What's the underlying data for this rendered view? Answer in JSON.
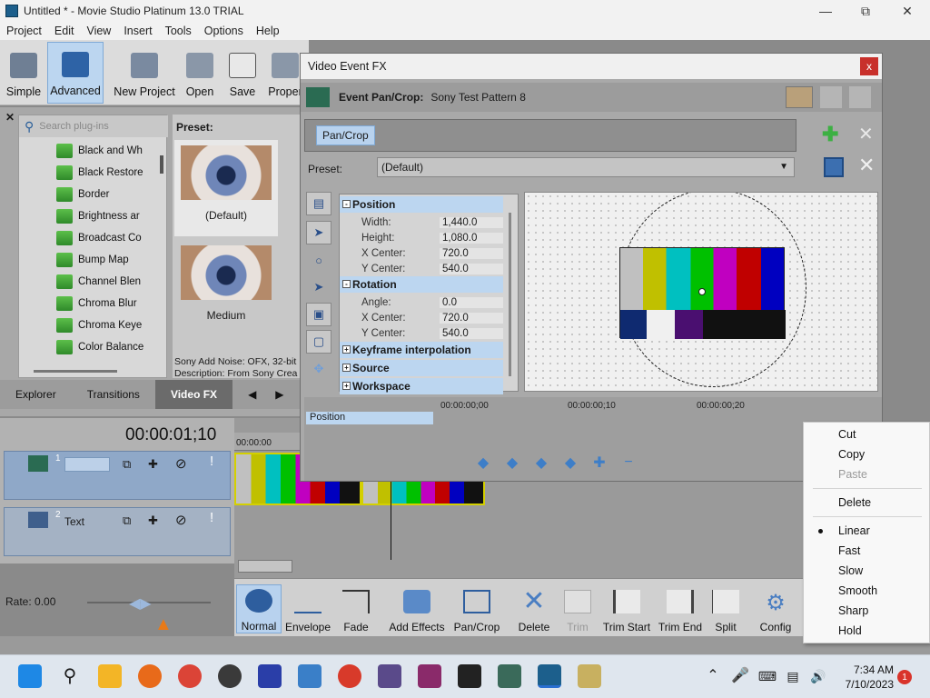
{
  "window": {
    "title": "Untitled * - Movie Studio Platinum 13.0 TRIAL"
  },
  "menu": [
    "Project",
    "Edit",
    "View",
    "Insert",
    "Tools",
    "Options",
    "Help"
  ],
  "toolbar": [
    "Simple",
    "Advanced",
    "New Project",
    "Open",
    "Save",
    "Proper"
  ],
  "plugins": {
    "search_placeholder": "Search plug-ins",
    "items": [
      "Black and Wh",
      "Black Restore",
      "Border",
      "Brightness ar",
      "Broadcast Co",
      "Bump Map",
      "Channel Blen",
      "Chroma Blur",
      "Chroma Keye",
      "Color Balance"
    ]
  },
  "presets": {
    "label": "Preset:",
    "thumbs": [
      "(Default)",
      "Medium"
    ],
    "desc1": "Sony Add Noise: OFX, 32-bit",
    "desc2": "Description: From Sony Crea"
  },
  "tabs": [
    "Explorer",
    "Transitions",
    "Video FX"
  ],
  "timeline": {
    "timecode": "00:00:01;10",
    "ruler_start": "00:00:00",
    "tracks": [
      {
        "num": "1",
        "name": ""
      },
      {
        "num": "2",
        "name": "Text"
      }
    ],
    "rate": "Rate: 0.00"
  },
  "bottom_tools": [
    "Normal",
    "Envelope",
    "Fade",
    "Add Effects",
    "Pan/Crop",
    "Delete",
    "Trim",
    "Trim Start",
    "Trim End",
    "Split",
    "Config"
  ],
  "fx": {
    "title": "Video Event FX",
    "close": "x",
    "header_label": "Event Pan/Crop:",
    "header_value": "Sony Test Pattern 8",
    "chain_button": "Pan/Crop",
    "preset_label": "Preset:",
    "preset_value": "(Default)",
    "groups": {
      "position": "Position",
      "rotation": "Rotation",
      "keyframe": "Keyframe interpolation",
      "source": "Source",
      "workspace": "Workspace"
    },
    "position_rows": [
      {
        "k": "Width:",
        "v": "1,440.0"
      },
      {
        "k": "Height:",
        "v": "1,080.0"
      },
      {
        "k": "X Center:",
        "v": "720.0"
      },
      {
        "k": "Y Center:",
        "v": "540.0"
      }
    ],
    "rotation_rows": [
      {
        "k": "Angle:",
        "v": "0.0"
      },
      {
        "k": "X Center:",
        "v": "720.0"
      },
      {
        "k": "Y Center:",
        "v": "540.0"
      }
    ],
    "keyframe_row": "Position",
    "kf_ticks": [
      "00:00:00;00",
      "00:00:00;10",
      "00:00:00;20"
    ]
  },
  "context_menu": {
    "cut": "Cut",
    "copy": "Copy",
    "paste": "Paste",
    "delete": "Delete",
    "linear": "Linear",
    "fast": "Fast",
    "slow": "Slow",
    "smooth": "Smooth",
    "sharp": "Sharp",
    "hold": "Hold"
  },
  "taskbar": {
    "time": "7:34 AM",
    "date": "7/10/2023",
    "badge": "1"
  }
}
